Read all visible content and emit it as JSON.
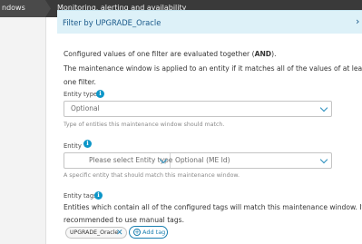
{
  "breadcrumb": {
    "first": "ndows",
    "second": "Monitoring, alerting and availability"
  },
  "panel": {
    "title": "Filter by UPGRADE_Oracle",
    "close_glyph": "›"
  },
  "intro": {
    "line1_prefix": "Configured values of one filter are evaluated together (",
    "line1_bold": "AND",
    "line1_suffix": ").",
    "line2": "The maintenance window is applied to an entity if it matches all of the values of at least",
    "line3": "one filter."
  },
  "entity_type": {
    "label": "Entity type",
    "value": "Optional",
    "help": "Type of entities this maintenance window should match."
  },
  "entity": {
    "label": "Entity",
    "type_placeholder": "Please select Entity type",
    "id_placeholder": "Optional (ME Id)",
    "help": "A specific entity that should match this maintenance window."
  },
  "entity_tags": {
    "label": "Entity tags",
    "desc_line1": "Entities which contain all of the configured tags will match this maintenance window. It is",
    "desc_line2": "recommended to use manual tags.",
    "tags": [
      "UPGRADE_Oracle"
    ],
    "add_label": "Add tag"
  },
  "icons": {
    "info": "info-icon",
    "chevron": "chevron-down-icon",
    "remove": "close-icon",
    "add": "plus-icon"
  },
  "colors": {
    "accent": "#0d96c8",
    "link": "#1b7fb0",
    "panel_header_bg": "#ddf1f8",
    "breadcrumb_bg": "#3a3a3a"
  }
}
